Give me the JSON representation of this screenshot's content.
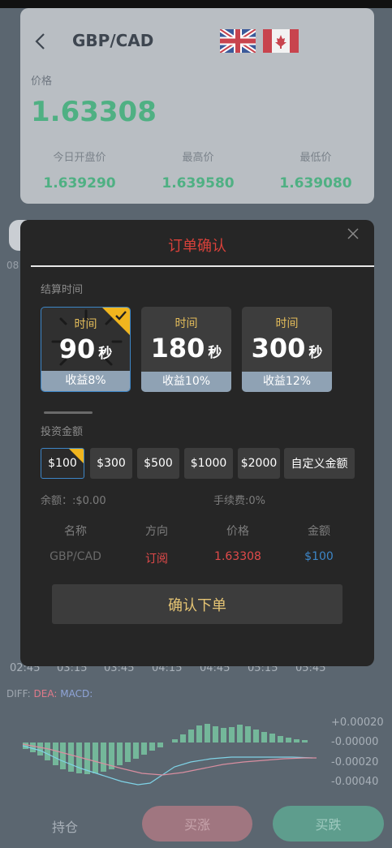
{
  "header": {
    "pair": "GBP/CAD",
    "price_label": "价格",
    "price": "1.63308",
    "stats": [
      {
        "label": "今日开盘价",
        "value": "1.639290"
      },
      {
        "label": "最高价",
        "value": "1.639580"
      },
      {
        "label": "最低价",
        "value": "1.639080"
      }
    ],
    "flags": [
      "uk-flag-icon",
      "canada-flag-icon"
    ]
  },
  "background": {
    "partial_label": "08",
    "time_axis": [
      "02:45",
      "03:15",
      "03:45",
      "04:15",
      "04:45",
      "05:15",
      "05:45"
    ],
    "indicator": {
      "diff": "DIFF:",
      "dea": "DEA:",
      "macd": "MACD:"
    },
    "y_axis": [
      "+0.00020",
      "-0.00000",
      "-0.00020",
      "-0.00040"
    ],
    "bottom_bar": {
      "hold": "持仓",
      "buy_up": "买涨",
      "buy_down": "买跌"
    }
  },
  "modal": {
    "title": "订单确认",
    "settle_label": "结算时间",
    "time_options": [
      {
        "label": "时间",
        "num": "90",
        "unit": "秒",
        "profit": "收益8%",
        "selected": true
      },
      {
        "label": "时间",
        "num": "180",
        "unit": "秒",
        "profit": "收益10%",
        "selected": false
      },
      {
        "label": "时间",
        "num": "300",
        "unit": "秒",
        "profit": "收益12%",
        "selected": false
      }
    ],
    "invest_label": "投资金额",
    "amounts": [
      "$100",
      "$300",
      "$500",
      "$1000",
      "$2000",
      "自定义金额"
    ],
    "selected_amount": "$100",
    "balance": "余额：:$0.00",
    "fee": "手续费:0%",
    "table": {
      "headers": [
        "名称",
        "方向",
        "价格",
        "金额"
      ],
      "row": [
        "GBP/CAD",
        "订阅",
        "1.63308",
        "$100"
      ]
    },
    "confirm": "确认下单"
  },
  "colors": {
    "accent_red": "#d8413a",
    "gold": "#e3bc5a",
    "green": "#4fb083",
    "blue": "#3d86c7"
  }
}
